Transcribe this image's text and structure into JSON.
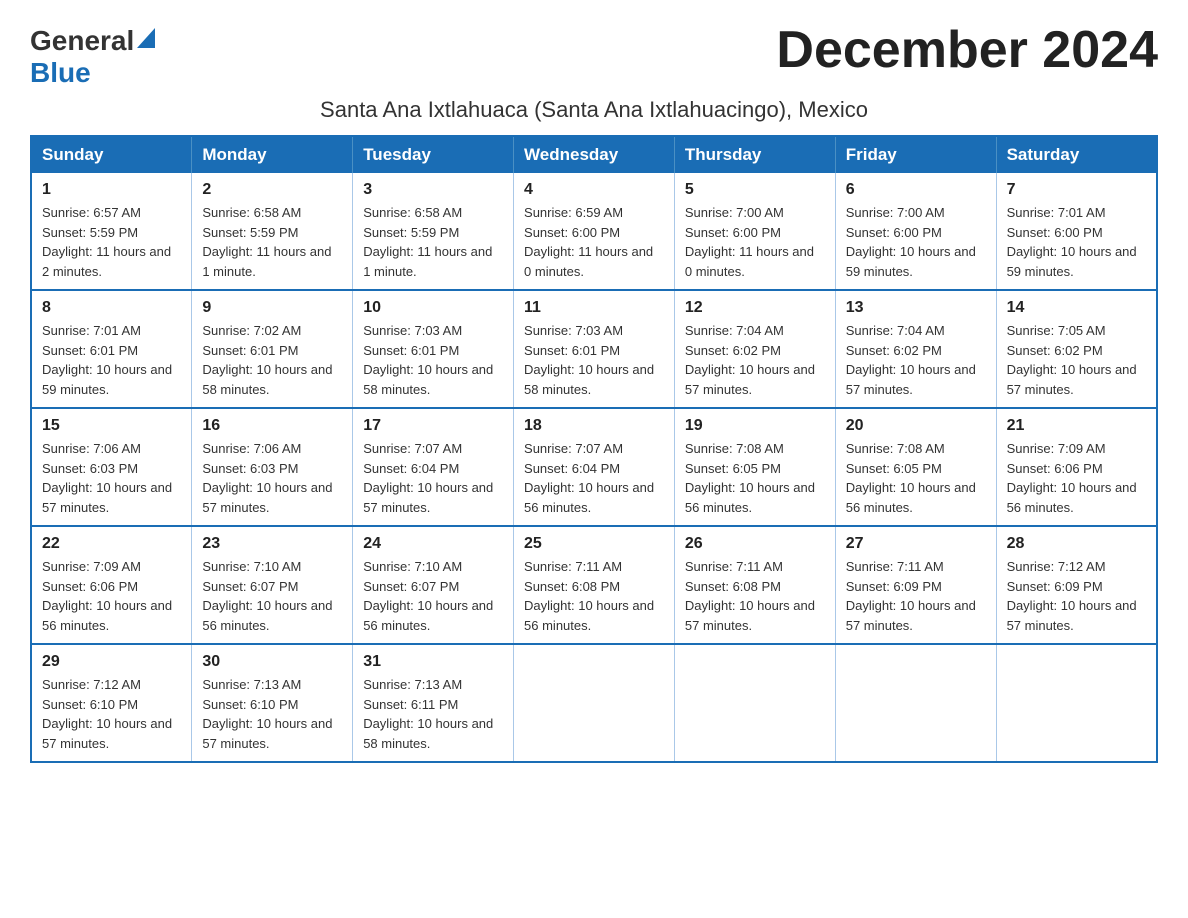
{
  "header": {
    "logo_general": "General",
    "logo_blue": "Blue",
    "month_title": "December 2024",
    "location": "Santa Ana Ixtlahuaca (Santa Ana Ixtlahuacingo), Mexico"
  },
  "weekdays": [
    "Sunday",
    "Monday",
    "Tuesday",
    "Wednesday",
    "Thursday",
    "Friday",
    "Saturday"
  ],
  "weeks": [
    [
      {
        "day": "1",
        "sunrise": "6:57 AM",
        "sunset": "5:59 PM",
        "daylight": "11 hours and 2 minutes."
      },
      {
        "day": "2",
        "sunrise": "6:58 AM",
        "sunset": "5:59 PM",
        "daylight": "11 hours and 1 minute."
      },
      {
        "day": "3",
        "sunrise": "6:58 AM",
        "sunset": "5:59 PM",
        "daylight": "11 hours and 1 minute."
      },
      {
        "day": "4",
        "sunrise": "6:59 AM",
        "sunset": "6:00 PM",
        "daylight": "11 hours and 0 minutes."
      },
      {
        "day": "5",
        "sunrise": "7:00 AM",
        "sunset": "6:00 PM",
        "daylight": "11 hours and 0 minutes."
      },
      {
        "day": "6",
        "sunrise": "7:00 AM",
        "sunset": "6:00 PM",
        "daylight": "10 hours and 59 minutes."
      },
      {
        "day": "7",
        "sunrise": "7:01 AM",
        "sunset": "6:00 PM",
        "daylight": "10 hours and 59 minutes."
      }
    ],
    [
      {
        "day": "8",
        "sunrise": "7:01 AM",
        "sunset": "6:01 PM",
        "daylight": "10 hours and 59 minutes."
      },
      {
        "day": "9",
        "sunrise": "7:02 AM",
        "sunset": "6:01 PM",
        "daylight": "10 hours and 58 minutes."
      },
      {
        "day": "10",
        "sunrise": "7:03 AM",
        "sunset": "6:01 PM",
        "daylight": "10 hours and 58 minutes."
      },
      {
        "day": "11",
        "sunrise": "7:03 AM",
        "sunset": "6:01 PM",
        "daylight": "10 hours and 58 minutes."
      },
      {
        "day": "12",
        "sunrise": "7:04 AM",
        "sunset": "6:02 PM",
        "daylight": "10 hours and 57 minutes."
      },
      {
        "day": "13",
        "sunrise": "7:04 AM",
        "sunset": "6:02 PM",
        "daylight": "10 hours and 57 minutes."
      },
      {
        "day": "14",
        "sunrise": "7:05 AM",
        "sunset": "6:02 PM",
        "daylight": "10 hours and 57 minutes."
      }
    ],
    [
      {
        "day": "15",
        "sunrise": "7:06 AM",
        "sunset": "6:03 PM",
        "daylight": "10 hours and 57 minutes."
      },
      {
        "day": "16",
        "sunrise": "7:06 AM",
        "sunset": "6:03 PM",
        "daylight": "10 hours and 57 minutes."
      },
      {
        "day": "17",
        "sunrise": "7:07 AM",
        "sunset": "6:04 PM",
        "daylight": "10 hours and 57 minutes."
      },
      {
        "day": "18",
        "sunrise": "7:07 AM",
        "sunset": "6:04 PM",
        "daylight": "10 hours and 56 minutes."
      },
      {
        "day": "19",
        "sunrise": "7:08 AM",
        "sunset": "6:05 PM",
        "daylight": "10 hours and 56 minutes."
      },
      {
        "day": "20",
        "sunrise": "7:08 AM",
        "sunset": "6:05 PM",
        "daylight": "10 hours and 56 minutes."
      },
      {
        "day": "21",
        "sunrise": "7:09 AM",
        "sunset": "6:06 PM",
        "daylight": "10 hours and 56 minutes."
      }
    ],
    [
      {
        "day": "22",
        "sunrise": "7:09 AM",
        "sunset": "6:06 PM",
        "daylight": "10 hours and 56 minutes."
      },
      {
        "day": "23",
        "sunrise": "7:10 AM",
        "sunset": "6:07 PM",
        "daylight": "10 hours and 56 minutes."
      },
      {
        "day": "24",
        "sunrise": "7:10 AM",
        "sunset": "6:07 PM",
        "daylight": "10 hours and 56 minutes."
      },
      {
        "day": "25",
        "sunrise": "7:11 AM",
        "sunset": "6:08 PM",
        "daylight": "10 hours and 56 minutes."
      },
      {
        "day": "26",
        "sunrise": "7:11 AM",
        "sunset": "6:08 PM",
        "daylight": "10 hours and 57 minutes."
      },
      {
        "day": "27",
        "sunrise": "7:11 AM",
        "sunset": "6:09 PM",
        "daylight": "10 hours and 57 minutes."
      },
      {
        "day": "28",
        "sunrise": "7:12 AM",
        "sunset": "6:09 PM",
        "daylight": "10 hours and 57 minutes."
      }
    ],
    [
      {
        "day": "29",
        "sunrise": "7:12 AM",
        "sunset": "6:10 PM",
        "daylight": "10 hours and 57 minutes."
      },
      {
        "day": "30",
        "sunrise": "7:13 AM",
        "sunset": "6:10 PM",
        "daylight": "10 hours and 57 minutes."
      },
      {
        "day": "31",
        "sunrise": "7:13 AM",
        "sunset": "6:11 PM",
        "daylight": "10 hours and 58 minutes."
      },
      null,
      null,
      null,
      null
    ]
  ]
}
